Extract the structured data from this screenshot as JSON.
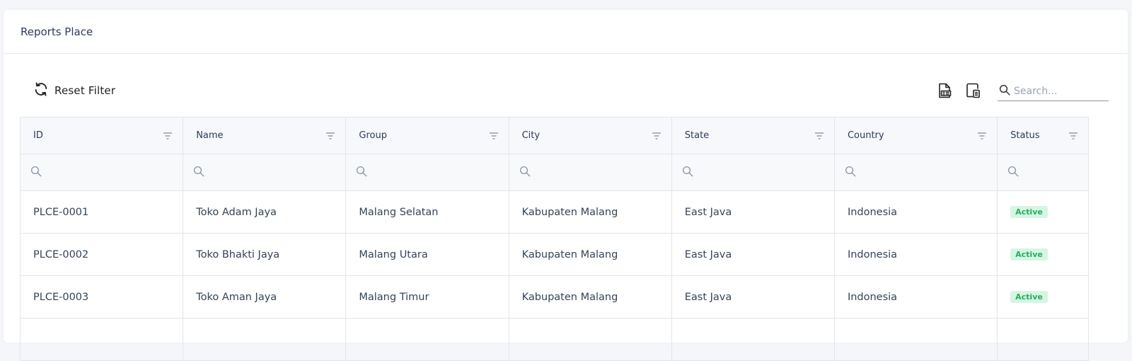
{
  "card": {
    "title": "Reports Place"
  },
  "toolbar": {
    "reset_label": "Reset Filter",
    "reset_icon": "refresh-icon",
    "export_excel_icon": "file-export-icon",
    "export_pdf_icon": "document-export-icon",
    "search_placeholder": "Search..."
  },
  "table": {
    "columns": [
      "ID",
      "Name",
      "Group",
      "City",
      "State",
      "Country",
      "Status"
    ],
    "rows": [
      [
        "PLCE-0001",
        "Toko Adam Jaya",
        "Malang Selatan",
        "Kabupaten Malang",
        "East Java",
        "Indonesia",
        "Active"
      ],
      [
        "PLCE-0002",
        "Toko Bhakti Jaya",
        "Malang Utara",
        "Kabupaten Malang",
        "East Java",
        "Indonesia",
        "Active"
      ],
      [
        "PLCE-0003",
        "Toko Aman Jaya",
        "Malang Timur",
        "Kabupaten Malang",
        "East Java",
        "Indonesia",
        "Active"
      ]
    ]
  },
  "colors": {
    "status_active_bg": "#d6f5e3",
    "status_active_text": "#27ae60"
  }
}
